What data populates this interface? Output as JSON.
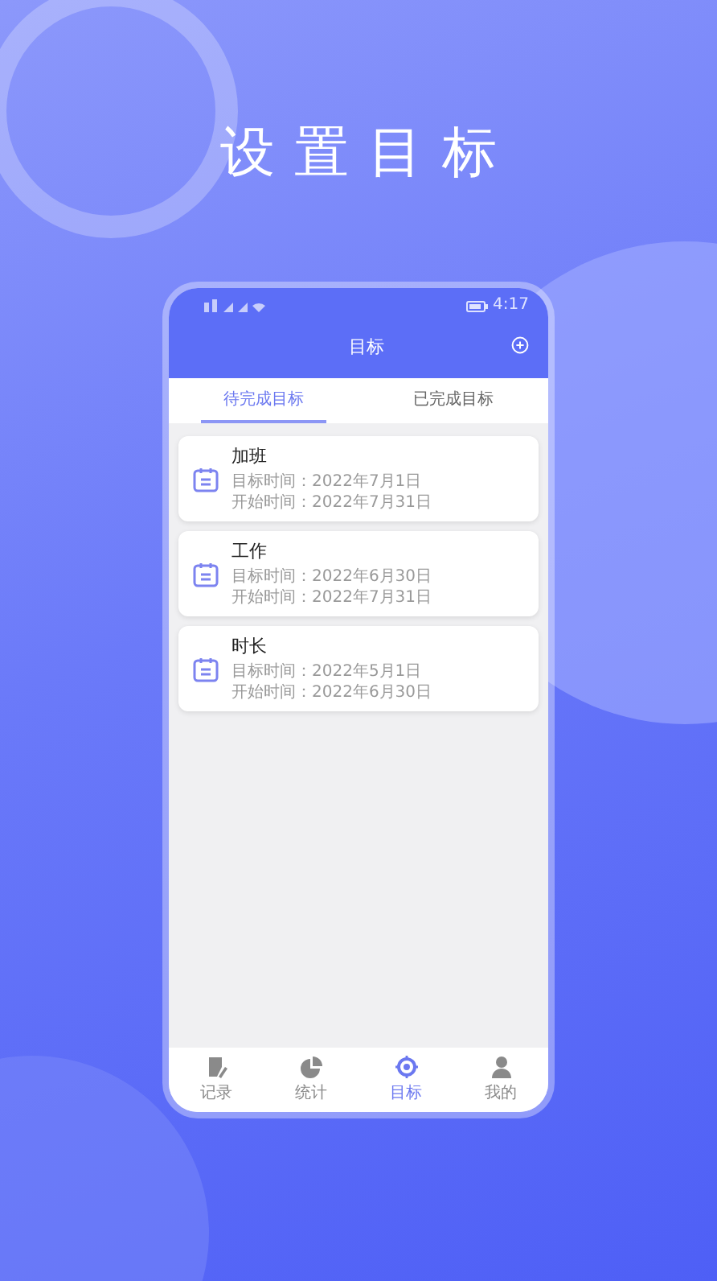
{
  "headline": "设置目标",
  "status_bar": {
    "time": "4:17"
  },
  "header": {
    "title": "目标"
  },
  "tabs": [
    {
      "label": "待完成目标",
      "selected": true
    },
    {
      "label": "已完成目标",
      "selected": false
    }
  ],
  "goals": [
    {
      "name": "加班",
      "target": "目标时间：2022年7月1日",
      "start": "开始时间：2022年7月31日"
    },
    {
      "name": "工作",
      "target": "目标时间：2022年6月30日",
      "start": "开始时间：2022年7月31日"
    },
    {
      "name": "时长",
      "target": "目标时间：2022年5月1日",
      "start": "开始时间：2022年6月30日"
    }
  ],
  "nav": [
    {
      "label": "记录",
      "kind": "record",
      "selected": false
    },
    {
      "label": "统计",
      "kind": "stats",
      "selected": false
    },
    {
      "label": "目标",
      "kind": "target",
      "selected": true
    },
    {
      "label": "我的",
      "kind": "profile",
      "selected": false
    }
  ]
}
